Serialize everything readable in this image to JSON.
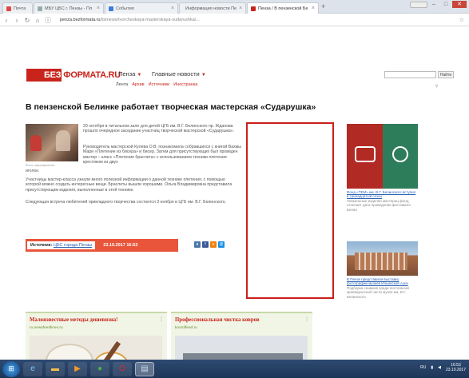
{
  "browser": {
    "tabs": [
      {
        "label": "Почта",
        "active": false
      },
      {
        "label": "МБУ ЦБС г. Пензы - Пл",
        "active": false
      },
      {
        "label": "События",
        "active": false
      },
      {
        "label": "Информация новости Пе",
        "active": false
      },
      {
        "label": "Пенза / В пензенской Бе",
        "active": true
      }
    ],
    "new_tab": "+",
    "window_controls": [
      "–",
      "□",
      "✕"
    ],
    "url_host": "penza.bezformata.ru",
    "url_path": "/listnews/tvorcheskaya-masterskaya-sudarushka/..."
  },
  "site": {
    "logo_mark": "БЕЗ",
    "logo_text": "ФОРМАТА.RU",
    "city_label": "Пенза",
    "news_label": "Главные новости",
    "subnav": [
      "Лента",
      "Архив",
      "Источники",
      "Иностранка"
    ],
    "search_button": "Найти"
  },
  "article": {
    "title": "В пензенской Белинке работает творческая мастерская «Сударушка»",
    "photo_caption": "Фото: мероприятия",
    "para1": "20 октября в читальном зале для детей ЦГБ им. В.Г. Белинского пр. Жданова прошло очередное заседание участниц творческой мастерской «Сударушка».",
    "para1_link": "«Сударушка»",
    "para2": "Руководитель мастерской Кулева О.В. познакомила собравшихся с книгой Вахмы Мари «Плетение из бисера» и бисер. Затем для присутствующих был проведен мастер – класс «Плетение браслета» с использованием техники плетения крестиком из двух",
    "para2_tail": "иголок.",
    "para3": "Участницы мастер-класса узнали много полезной информации о данной технике плетения, с помощью которой можно создать интересные вещи. Браслеты вышли хорошими. Ольга Владимировна представила присутствующим изделия, выполненные в этой технике.",
    "para4": "Следующая встреча любителей прикладного творчества состоится 3 ноября в ЦГБ им. В.Г. Белинского."
  },
  "source": {
    "label": "Источник:",
    "link": "ЦБС города Пензы",
    "date": "23.10.2017 16:52"
  },
  "share_buttons": [
    {
      "name": "vk-icon",
      "glyph": "в",
      "color": "#4a76a8"
    },
    {
      "name": "facebook-icon",
      "glyph": "f",
      "color": "#3b5998"
    },
    {
      "name": "odnoklassniki-icon",
      "glyph": "о",
      "color": "#ee8208"
    },
    {
      "name": "mail-icon",
      "glyph": "@",
      "color": "#168de2"
    }
  ],
  "sidebar": {
    "item1_link": "Фонд «ТЕМ» им. В.Г. Белинского вступил в тринадцатый сезон",
    "item1_text": "Уникальные изделия мастериц фонд отличает дата проведения фестиваля Белая",
    "item2_link": "В Пензе представили выставку фотографии музеев Ильинской Азиз",
    "item2_text": "Подборка снимков среди постоянной краеведческой части музея им. В.Г. Белинского"
  },
  "teasers": [
    {
      "title": "Малоизвестные методы дешевизна!",
      "source": "ru.newsfeedlines.ru",
      "menu": "⋮"
    },
    {
      "title": "Профессиональная чистка ковров",
      "source": "kovroffeed.ru",
      "menu": "⋮"
    }
  ],
  "taskbar": {
    "clock_time": "16:53",
    "clock_date": "23.10.2017",
    "lang": "RU"
  }
}
